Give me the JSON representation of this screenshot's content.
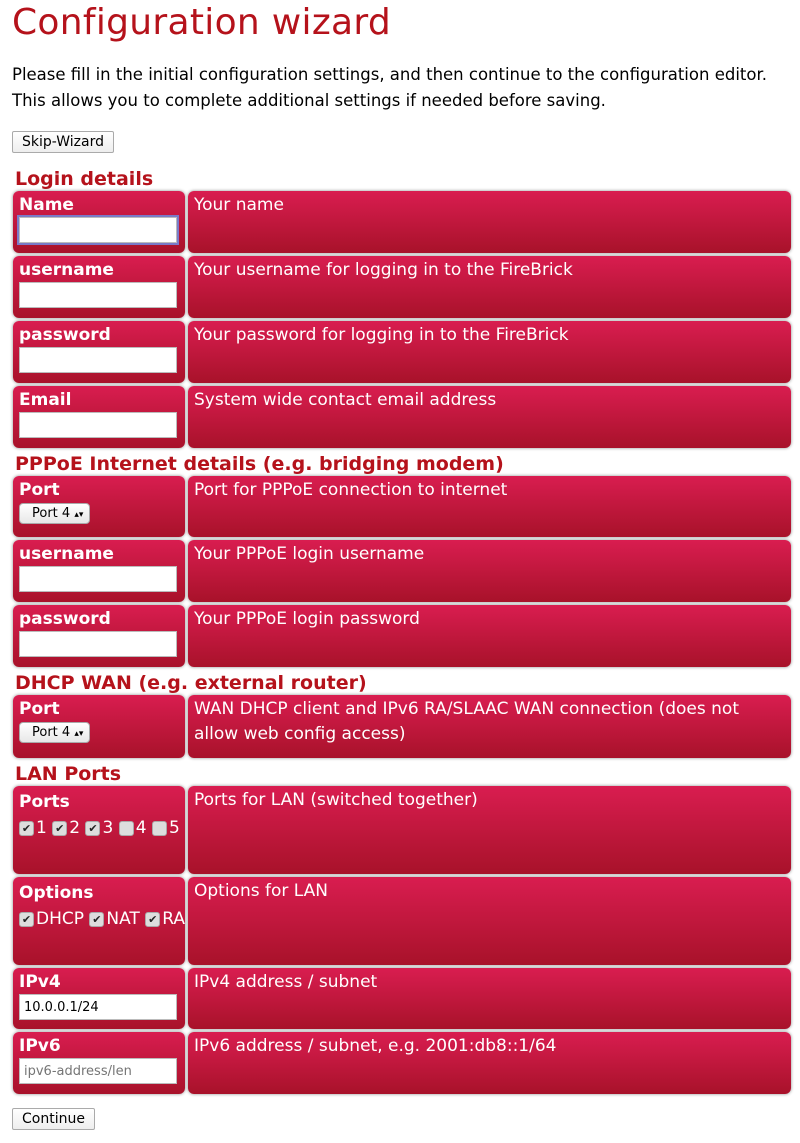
{
  "title": "Configuration wizard",
  "intro": "Please fill in the initial configuration settings, and then continue to the configuration editor. This allows you to complete additional settings if needed before saving.",
  "skip_label": "Skip-Wizard",
  "continue_label": "Continue",
  "sections": {
    "login": {
      "heading": "Login details",
      "name": {
        "label": "Name",
        "desc": "Your name",
        "value": ""
      },
      "username": {
        "label": "username",
        "desc": "Your username for logging in to the FireBrick",
        "value": ""
      },
      "password": {
        "label": "password",
        "desc": "Your password for logging in to the FireBrick",
        "value": ""
      },
      "email": {
        "label": "Email",
        "desc": "System wide contact email address",
        "value": ""
      }
    },
    "pppoe": {
      "heading": "PPPoE Internet details (e.g. bridging modem)",
      "port": {
        "label": "Port",
        "desc": "Port for PPPoE connection to internet",
        "selected": "Port 4"
      },
      "username": {
        "label": "username",
        "desc": "Your PPPoE login username",
        "value": ""
      },
      "password": {
        "label": "password",
        "desc": "Your PPPoE login password",
        "value": ""
      }
    },
    "dhcp": {
      "heading": "DHCP WAN (e.g. external router)",
      "port": {
        "label": "Port",
        "desc": "WAN DHCP client and IPv6 RA/SLAAC WAN connection (does not allow web config access)",
        "selected": "Port 4"
      }
    },
    "lan": {
      "heading": "LAN Ports",
      "ports": {
        "label": "Ports",
        "desc": "Ports for LAN (switched together)",
        "items": [
          {
            "label": "1",
            "checked": true
          },
          {
            "label": "2",
            "checked": true
          },
          {
            "label": "3",
            "checked": true
          },
          {
            "label": "4",
            "checked": false
          },
          {
            "label": "5",
            "checked": false
          }
        ]
      },
      "options": {
        "label": "Options",
        "desc": "Options for LAN",
        "items": [
          {
            "label": "DHCP",
            "checked": true
          },
          {
            "label": "NAT",
            "checked": true
          },
          {
            "label": "RA",
            "checked": true
          }
        ]
      },
      "ipv4": {
        "label": "IPv4",
        "desc": "IPv4 address / subnet",
        "value": "10.0.0.1/24"
      },
      "ipv6": {
        "label": "IPv6",
        "desc": "IPv6 address / subnet, e.g. 2001:db8::1/64",
        "value": "",
        "placeholder": "ipv6-address/len"
      }
    }
  },
  "colors": {
    "accent": "#b5121b",
    "cell_top": "#d91d50",
    "cell_bottom": "#a8122a"
  }
}
